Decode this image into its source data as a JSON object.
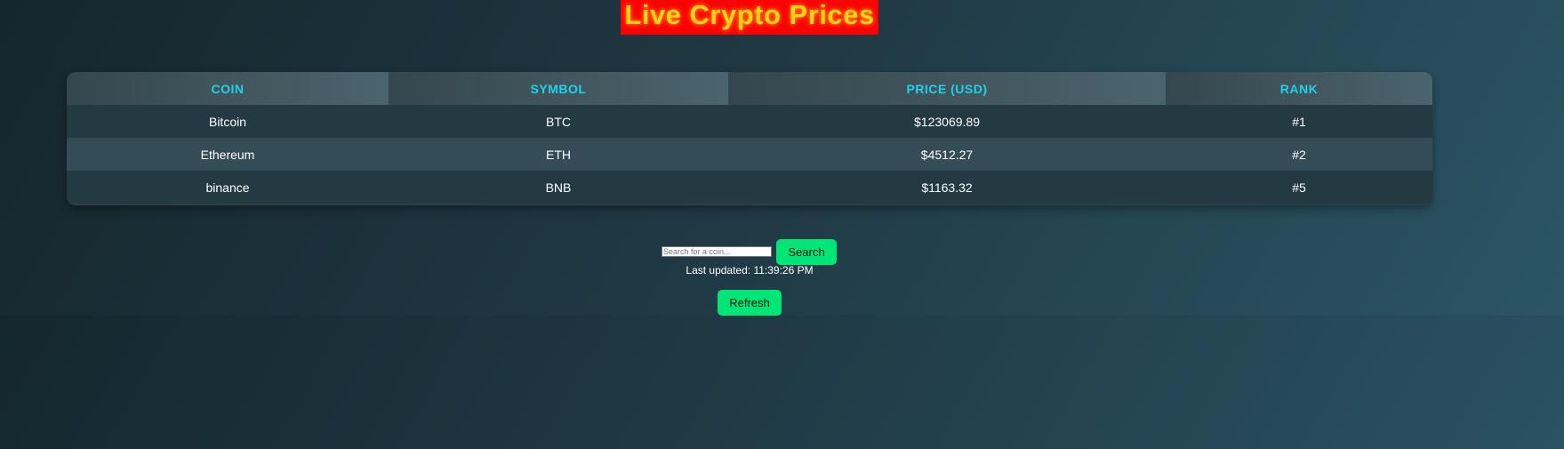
{
  "header": {
    "title": "Live Crypto Prices"
  },
  "table": {
    "columns": [
      "COIN",
      "SYMBOL",
      "PRICE (USD)",
      "RANK"
    ],
    "rows": [
      {
        "coin": "Bitcoin",
        "symbol": "BTC",
        "price": "$123069.89",
        "rank": "#1"
      },
      {
        "coin": "Ethereum",
        "symbol": "ETH",
        "price": "$4512.27",
        "rank": "#2"
      },
      {
        "coin": "binance",
        "symbol": "BNB",
        "price": "$1163.32",
        "rank": "#5"
      }
    ]
  },
  "search": {
    "placeholder": "Search for a coin...",
    "value": "",
    "button_label": "Search"
  },
  "status": {
    "last_updated": "Last updated: 11:39:26 PM"
  },
  "actions": {
    "refresh_label": "Refresh"
  },
  "colors": {
    "accent_button": "#00e676",
    "header_text": "#1fd3ea",
    "title_bg": "#ff0000",
    "title_text": "#ffd21a"
  }
}
